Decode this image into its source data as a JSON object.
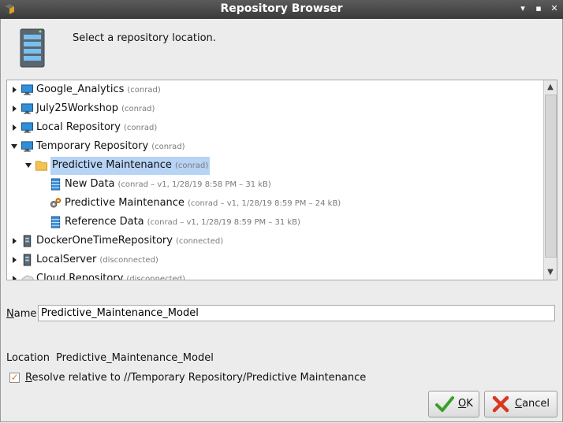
{
  "window": {
    "title": "Repository Browser",
    "controls": [
      "▾",
      "▪",
      "✕"
    ]
  },
  "header": {
    "text": "Select a repository location."
  },
  "tree": [
    {
      "label": "Google_Analytics",
      "meta": "(conrad)",
      "icon": "monitor-icon",
      "depth": 0,
      "toggle": "collapsed"
    },
    {
      "label": "July25Workshop",
      "meta": "(conrad)",
      "icon": "monitor-icon",
      "depth": 0,
      "toggle": "collapsed"
    },
    {
      "label": "Local Repository",
      "meta": "(conrad)",
      "icon": "monitor-icon",
      "depth": 0,
      "toggle": "collapsed"
    },
    {
      "label": "Temporary Repository",
      "meta": "(conrad)",
      "icon": "monitor-icon",
      "depth": 0,
      "toggle": "expanded"
    },
    {
      "label": "Predictive Maintenance",
      "meta": "(conrad)",
      "icon": "folder-icon",
      "depth": 1,
      "toggle": "expanded",
      "selected": true
    },
    {
      "label": "New Data",
      "meta": "(conrad – v1, 1/28/19 8:58 PM – 31 kB)",
      "icon": "data-table-icon",
      "depth": 2,
      "toggle": "none"
    },
    {
      "label": "Predictive Maintenance",
      "meta": "(conrad – v1, 1/28/19 8:59 PM – 24 kB)",
      "icon": "gears-icon",
      "depth": 2,
      "toggle": "none"
    },
    {
      "label": "Reference Data",
      "meta": "(conrad – v1, 1/28/19 8:59 PM – 31 kB)",
      "icon": "data-table-icon",
      "depth": 2,
      "toggle": "none"
    },
    {
      "label": "DockerOneTimeRepository",
      "meta": "(connected)",
      "icon": "server-icon",
      "depth": 0,
      "toggle": "collapsed"
    },
    {
      "label": "LocalServer",
      "meta": "(disconnected)",
      "icon": "server-icon",
      "depth": 0,
      "toggle": "collapsed"
    },
    {
      "label": "Cloud Repository",
      "meta": "(disconnected)",
      "icon": "cloud-icon",
      "depth": 0,
      "toggle": "collapsed"
    }
  ],
  "name_field": {
    "label_accel": "N",
    "label_rest": "ame",
    "value": "Predictive_Maintenance_Model"
  },
  "location": {
    "label": "Location",
    "value": "Predictive_Maintenance_Model"
  },
  "resolve": {
    "checked": true,
    "label_accel": "R",
    "label_rest": "esolve relative to //Temporary Repository/Predictive Maintenance"
  },
  "buttons": {
    "ok": {
      "accel": "O",
      "rest": "K"
    },
    "cancel": {
      "accel": "C",
      "rest": "ancel"
    }
  },
  "colors": {
    "selection": "#b7d3f5",
    "check": "#e07a1e",
    "ok_icon": "#3aa02c",
    "cancel_icon": "#d9371f"
  }
}
